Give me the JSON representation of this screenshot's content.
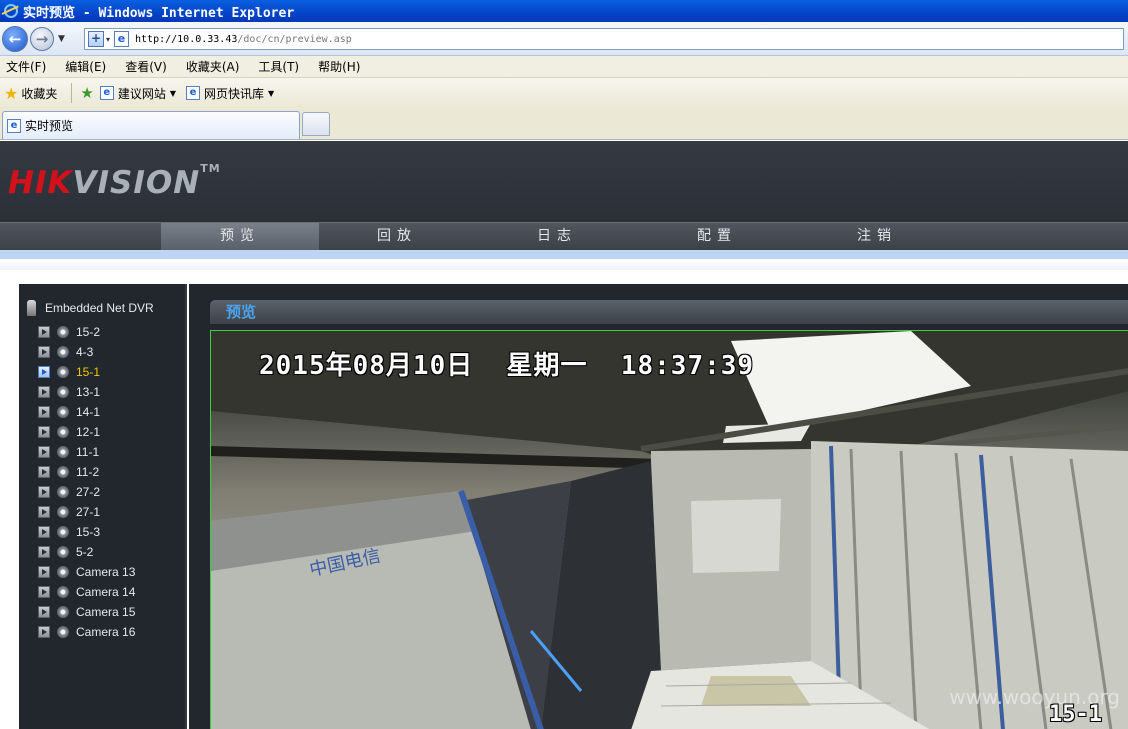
{
  "window": {
    "title": "实时预览 - Windows Internet Explorer"
  },
  "address": {
    "url_host": "http://10.0.33.43",
    "url_path": "/doc/cn/preview.asp"
  },
  "menu": [
    "文件(F)",
    "编辑(E)",
    "查看(V)",
    "收藏夹(A)",
    "工具(T)",
    "帮助(H)"
  ],
  "favorites": {
    "label": "收藏夹",
    "items": [
      "建议网站",
      "网页快讯库"
    ]
  },
  "tab": {
    "label": "实时预览"
  },
  "brand": {
    "part1": "HIK",
    "part2": "VISION",
    "tm": "TM"
  },
  "nav": [
    {
      "label": "预览",
      "active": true
    },
    {
      "label": "回放",
      "active": false
    },
    {
      "label": "日志",
      "active": false
    },
    {
      "label": "配置",
      "active": false
    },
    {
      "label": "注销",
      "active": false
    }
  ],
  "tree": {
    "root": "Embedded Net DVR",
    "cameras": [
      "15-2",
      "4-3",
      "15-1",
      "13-1",
      "14-1",
      "12-1",
      "11-1",
      "11-2",
      "27-2",
      "27-1",
      "15-3",
      "5-2",
      "Camera 13",
      "Camera 14",
      "Camera 15",
      "Camera 16"
    ],
    "active": "15-1"
  },
  "preview": {
    "header": "预览",
    "osd_time": "2015年08月10日  星期一  18:37:39",
    "osd_camera": "15-1",
    "watermark": "www.wooyun.org"
  },
  "colors": {
    "brand_red": "#d3111b",
    "active_camera": "#f6c400",
    "preview_title": "#4aa4f0",
    "video_border": "#3fce3f"
  }
}
